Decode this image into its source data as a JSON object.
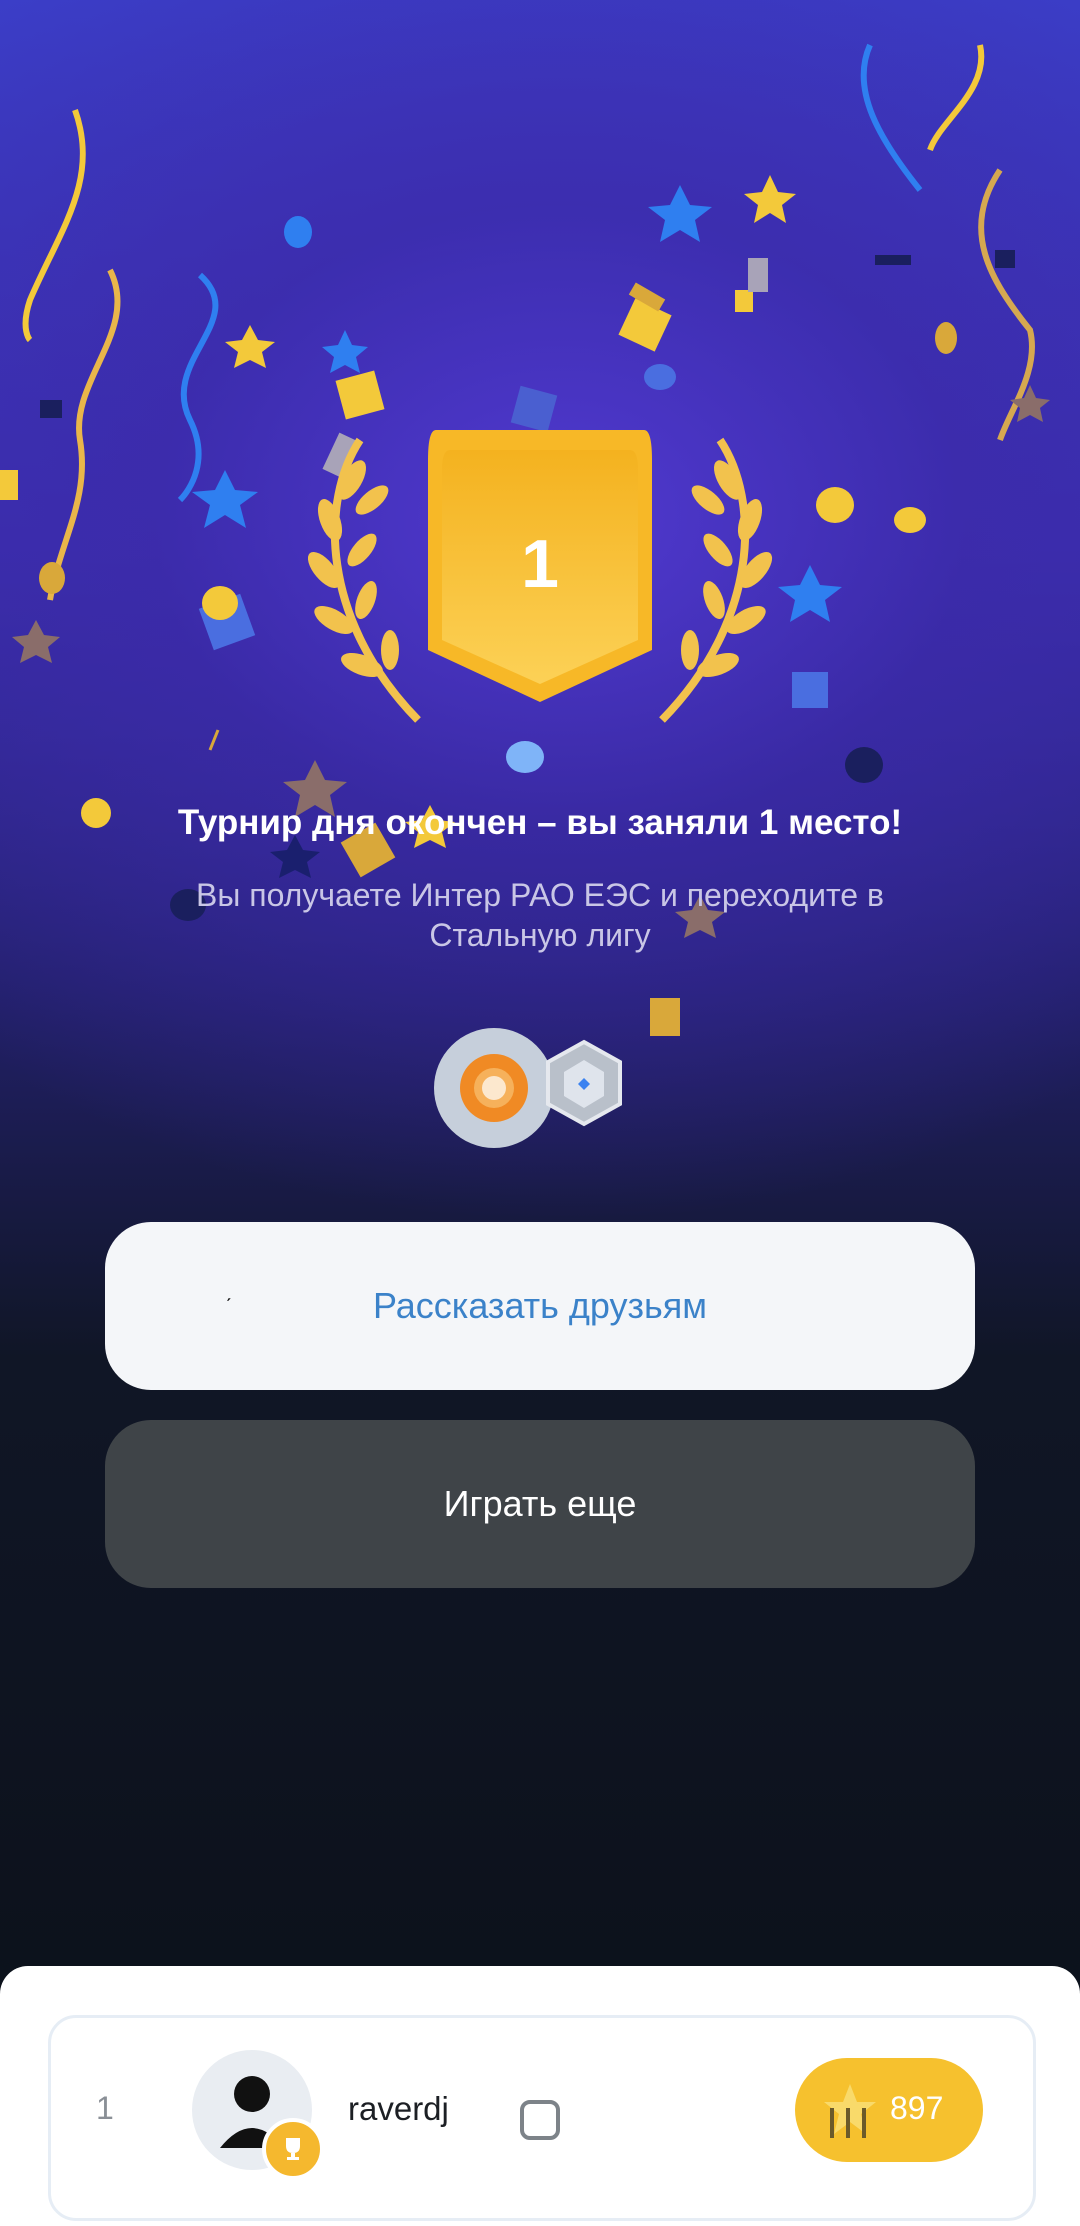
{
  "result": {
    "place_number": "1",
    "title": "Турнир дня окончен – вы заняли 1 место!",
    "subtitle": "Вы получаете Интер РАО ЕЭС и переходите в Стальную лигу"
  },
  "buttons": {
    "share_label": "Рассказать друзьям",
    "play_label": "Играть еще"
  },
  "leaderboard": {
    "rank": "1",
    "username": "raverdj",
    "score": "897"
  },
  "colors": {
    "accent_blue": "#3b82c9",
    "gold": "#f6c12e",
    "purple_bg": "#3a2fae"
  }
}
